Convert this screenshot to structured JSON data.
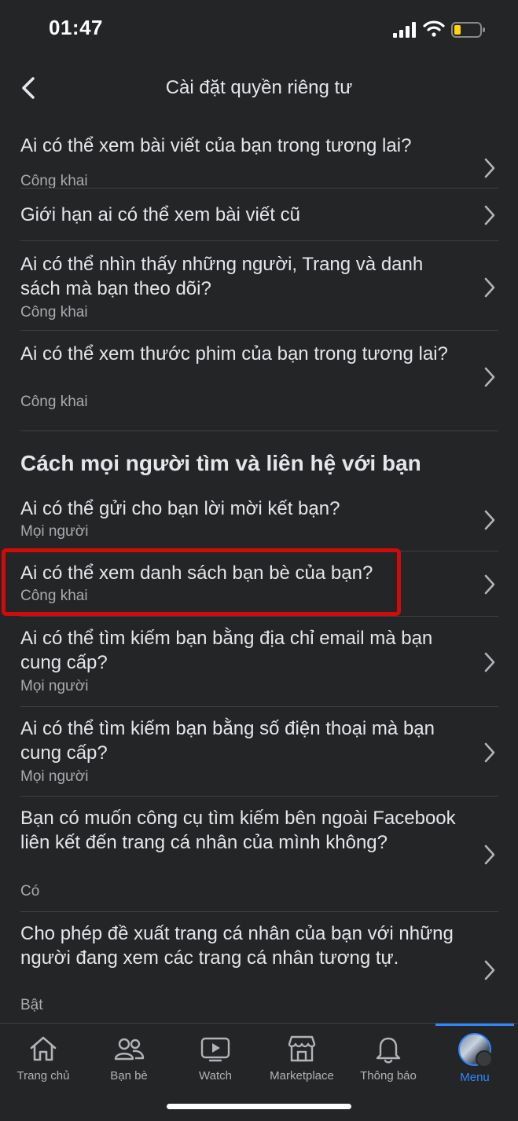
{
  "status": {
    "time": "01:47"
  },
  "nav": {
    "title": "Cài đặt quyền riêng tư"
  },
  "rows_top": [
    {
      "title": "Ai có thể xem bài viết của bạn trong tương lai?",
      "subtitle": "Công khai"
    },
    {
      "title": "Giới hạn ai có thể xem bài viết cũ",
      "subtitle": ""
    },
    {
      "title": "Ai có thể nhìn thấy những người, Trang và danh sách mà bạn theo dõi?",
      "subtitle": "Công khai"
    },
    {
      "title": "Ai có thể xem thước phim của bạn trong tương lai?",
      "subtitle": "Công khai"
    }
  ],
  "section": {
    "title": "Cách mọi người tìm và liên hệ với bạn"
  },
  "rows_bottom": [
    {
      "title": "Ai có thể gửi cho bạn lời mời kết bạn?",
      "subtitle": "Mọi người"
    },
    {
      "title": "Ai có thể xem danh sách bạn bè của bạn?",
      "subtitle": "Công khai"
    },
    {
      "title": "Ai có thể tìm kiếm bạn bằng địa chỉ email mà bạn cung cấp?",
      "subtitle": "Mọi người"
    },
    {
      "title": "Ai có thể tìm kiếm bạn bằng số điện thoại mà bạn cung cấp?",
      "subtitle": "Mọi người"
    },
    {
      "title": "Bạn có muốn công cụ tìm kiếm bên ngoài Facebook liên kết đến trang cá nhân của mình không?",
      "subtitle": "Có"
    },
    {
      "title": "Cho phép đề xuất trang cá nhân của bạn với những người đang xem các trang cá nhân tương tự.",
      "subtitle": "Bật"
    }
  ],
  "tabs": [
    {
      "label": "Trang chủ",
      "icon": "home-icon"
    },
    {
      "label": "Bạn bè",
      "icon": "friends-icon"
    },
    {
      "label": "Watch",
      "icon": "watch-icon"
    },
    {
      "label": "Marketplace",
      "icon": "marketplace-icon"
    },
    {
      "label": "Thông báo",
      "icon": "bell-icon"
    },
    {
      "label": "Menu",
      "icon": "avatar",
      "active": true
    }
  ],
  "colors": {
    "accent": "#2d88ff",
    "highlight": "#d10a0a",
    "background": "#242526"
  }
}
